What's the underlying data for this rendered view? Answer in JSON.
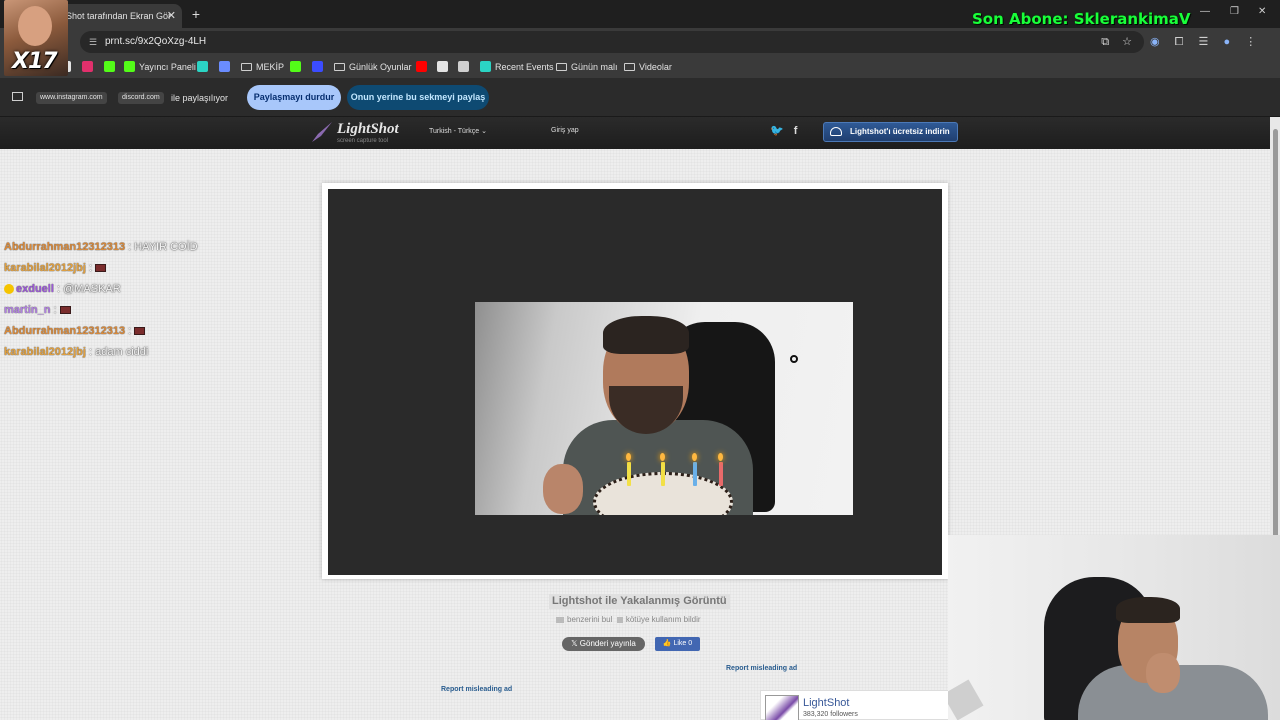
{
  "browser": {
    "tab_title": "Shot tarafından Ekran Gör",
    "tab_close": "✕",
    "new_tab": "+",
    "url": "prnt.sc/9x2QoXzg-4LH"
  },
  "overlay": {
    "avatar_caption": "X17",
    "son_abone": "Son Abone: SklerankimaV"
  },
  "bookmarks": [
    {
      "label": "",
      "icon": "x-icon",
      "color": "#e3e3e3"
    },
    {
      "label": "",
      "icon": "instagram-icon",
      "color": "#e1306c"
    },
    {
      "label": "",
      "icon": "kick-icon",
      "color": "#53fc18"
    },
    {
      "label": "Yayıncı Paneli",
      "icon": "kick-icon",
      "color": "#53fc18"
    },
    {
      "label": "",
      "icon": "app-icon",
      "color": "#2bd4c4"
    },
    {
      "label": "",
      "icon": "prompt-icon",
      "color": "#6a8cff"
    },
    {
      "label": "MEKİP",
      "icon": "folder-icon",
      "color": ""
    },
    {
      "label": "",
      "icon": "kick-icon",
      "color": "#53fc18"
    },
    {
      "label": "",
      "icon": "app-icon",
      "color": "#3b4cff"
    },
    {
      "label": "Günlük Oyunlar",
      "icon": "folder-icon",
      "color": ""
    },
    {
      "label": "",
      "icon": "youtube-icon",
      "color": "#ff0000"
    },
    {
      "label": "",
      "icon": "gamepad-icon",
      "color": "#e3e3e3"
    },
    {
      "label": "",
      "icon": "globe-icon",
      "color": "#cfcfcf"
    },
    {
      "label": "Recent Events",
      "icon": "app-icon",
      "color": "#2bd4c4"
    },
    {
      "label": "Günün malı",
      "icon": "folder-icon",
      "color": ""
    },
    {
      "label": "Videolar",
      "icon": "folder-icon",
      "color": ""
    }
  ],
  "sharebar": {
    "chip1": "www.instagram.com",
    "chip2": "discord.com",
    "text": "ile paylaşılıyor",
    "stop_button": "Paylaşmayı durdur",
    "share_button": "Onun yerine bu sekmeyi paylaş"
  },
  "lightshot": {
    "logo_name": "LightShot",
    "logo_sub": "screen capture tool",
    "language": "Turkish - Türkçe ⌄",
    "login": "Giriş yap",
    "twitter": "🐦",
    "facebook": "f",
    "download_button": "Lightshot'ı ücretsiz indirin",
    "caption_title": "Lightshot ile Yakalanmış Görüntü",
    "find_similar": "benzerini bul",
    "report_abuse": "kötüye kullanım bildir",
    "tweet_button": "𝕏 Gönderi yayınla",
    "fb_like": "👍 Like 0",
    "report_ad_1": "Report misleading ad",
    "report_ad_2": "Report misleading ad",
    "fb_page_name": "LightShot",
    "fb_followers": "383,320 followers"
  },
  "chat": [
    {
      "user": "Abdurrahman12312313",
      "color": "#d88a3c",
      "msg": ": HAYIR COİD",
      "emote": false,
      "badge": false
    },
    {
      "user": "karabilal2012jbj",
      "color": "#e0a040",
      "msg": ":",
      "emote": true,
      "badge": false
    },
    {
      "user": "exduell",
      "color": "#9b59d6",
      "msg": ": @MASKAR",
      "emote": false,
      "badge": true
    },
    {
      "user": "martin_n",
      "color": "#b080e0",
      "msg": ":",
      "emote": true,
      "badge": false
    },
    {
      "user": "Abdurrahman12312313",
      "color": "#d88a3c",
      "msg": ":",
      "emote": true,
      "badge": false
    },
    {
      "user": "karabilal2012jbj",
      "color": "#e0a040",
      "msg": ": adam ciddi",
      "emote": false,
      "badge": false
    }
  ]
}
